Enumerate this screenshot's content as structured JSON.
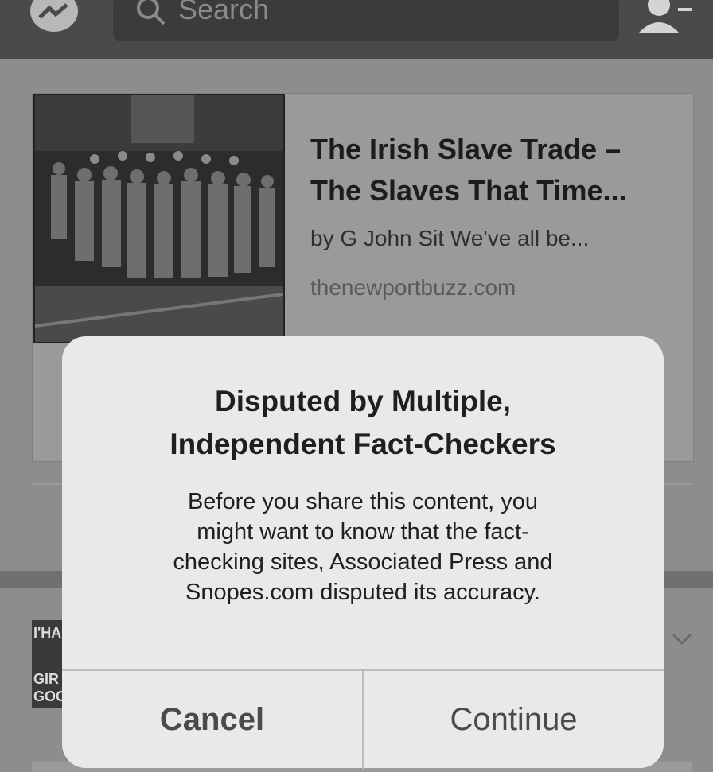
{
  "nav": {
    "search_placeholder": "Search"
  },
  "link_card": {
    "title_lines": [
      "The Irish Slave Trade –",
      "The Slaves That Time..."
    ],
    "byline": "by G John Sit We've all be...",
    "domain": "thenewportbuzz.com"
  },
  "next_post": {
    "avatar_text": [
      "I'HA",
      "GIR",
      "GOO"
    ]
  },
  "alert": {
    "title_lines": [
      "Disputed by Multiple,",
      "Independent Fact-Checkers"
    ],
    "body_lines": [
      "Before you share this content, you",
      "might want to know that the fact-",
      "checking sites, Associated Press and",
      "Snopes.com disputed its accuracy."
    ],
    "cancel_label": "Cancel",
    "continue_label": "Continue"
  },
  "icons": {
    "messenger": "messenger-icon",
    "search": "search-icon",
    "profile": "friend-requests-icon",
    "chevron": "chevron-down-icon"
  }
}
